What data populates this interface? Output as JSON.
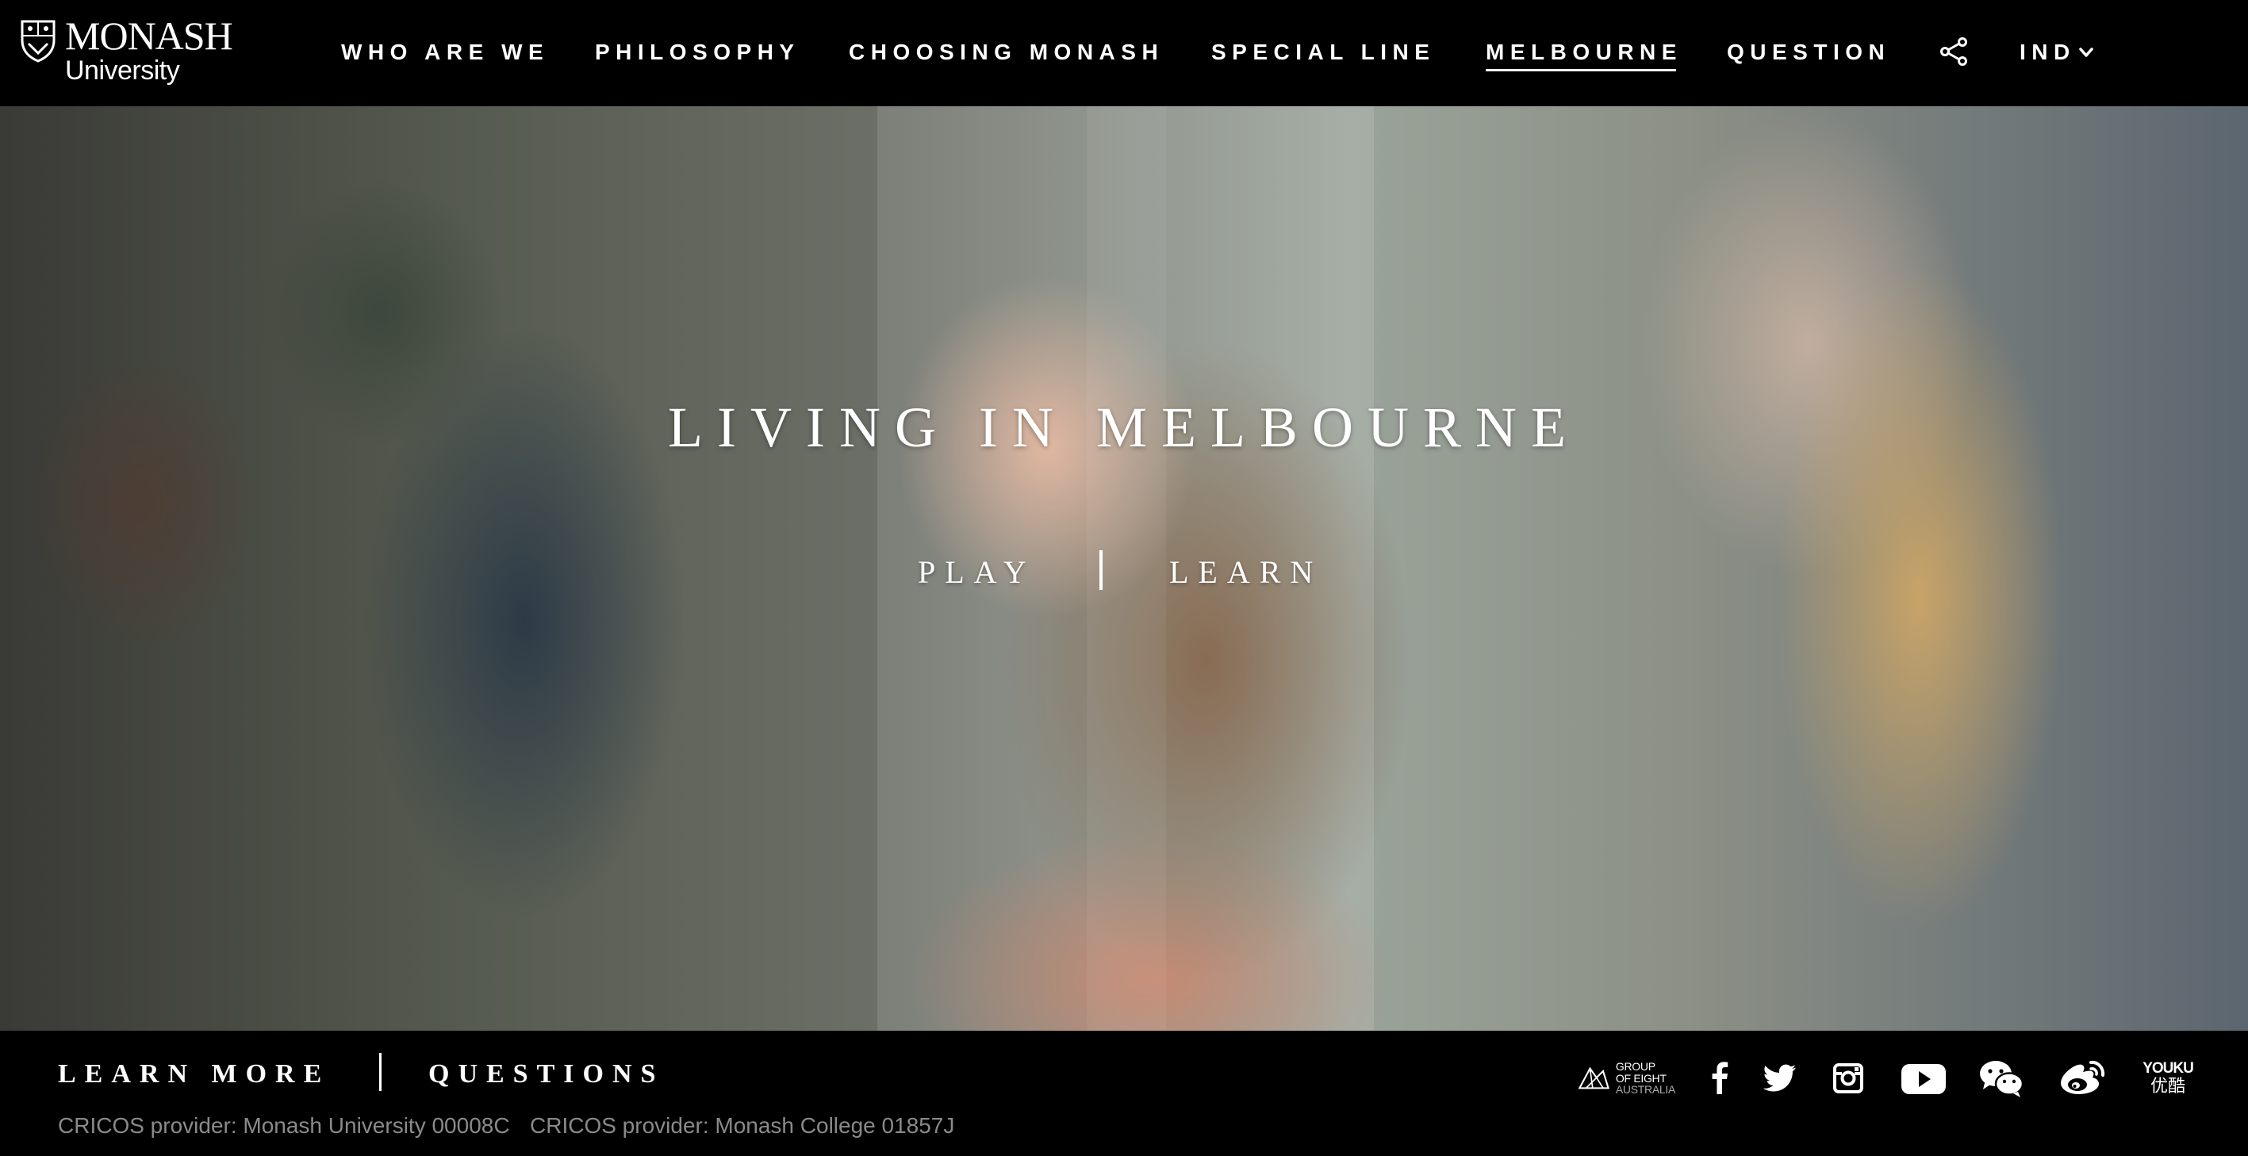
{
  "brand": {
    "name": "MONASH",
    "sub": "University"
  },
  "nav": {
    "items": [
      {
        "label": "WHO ARE WE"
      },
      {
        "label": "PHILOSOPHY"
      },
      {
        "label": "CHOOSING MONASH"
      },
      {
        "label": "SPECIAL LINE"
      },
      {
        "label": "MELBOURNE",
        "active": true
      },
      {
        "label": "QUESTION"
      }
    ],
    "share_icon": "share-icon",
    "language": "IND"
  },
  "hero": {
    "title": "LIVING IN MELBOURNE",
    "play_label": "PLAY",
    "learn_label": "LEARN"
  },
  "footer": {
    "learn_more_label": "LEARN MORE",
    "questions_label": "QUESTIONS",
    "cricos_university": "CRICOS provider: Monash University 00008C",
    "cricos_college": "CRICOS provider: Monash College 01857J",
    "go8": {
      "line1": "GROUP",
      "line2": "OF EIGHT",
      "line3": "AUSTRALIA"
    },
    "social_icons": [
      "go8-logo",
      "facebook-icon",
      "twitter-icon",
      "instagram-icon",
      "youtube-icon",
      "wechat-icon",
      "weibo-icon",
      "youku-icon"
    ],
    "youku": {
      "line1": "YOUKU",
      "line2": "优酷"
    }
  },
  "colors": {
    "background": "#000000",
    "text": "#ffffff",
    "muted": "#8a8a8a"
  }
}
